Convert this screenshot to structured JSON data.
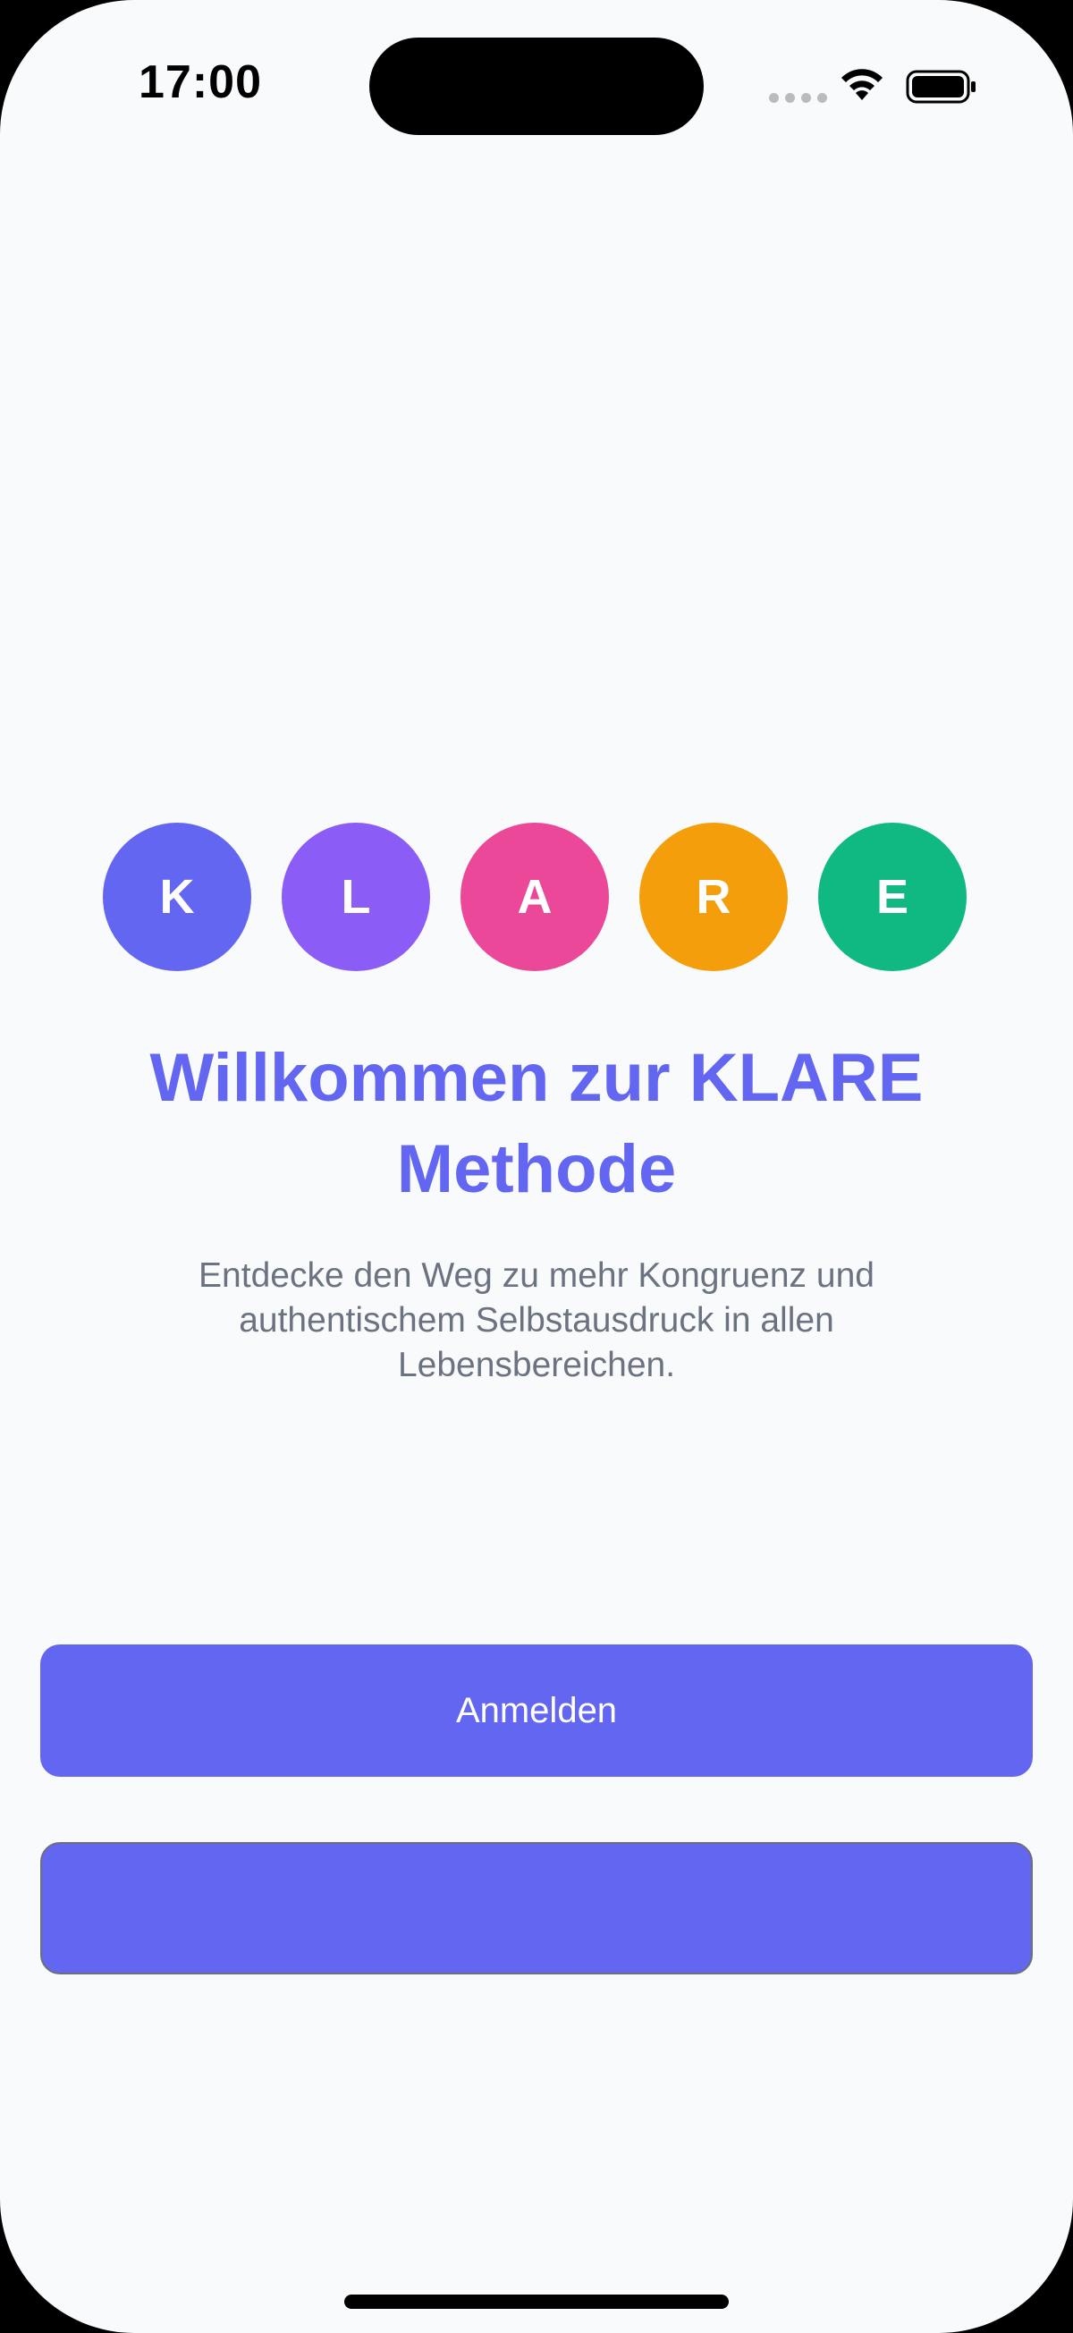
{
  "status_bar": {
    "time": "17:00",
    "icons": [
      "cellular-signal-icon",
      "wifi-icon",
      "battery-icon"
    ]
  },
  "colors": {
    "background": "#F8FAFC",
    "primary": "#6366F1",
    "subtitle": "#6B7280"
  },
  "letters": [
    {
      "char": "K",
      "color": "#6366F1"
    },
    {
      "char": "L",
      "color": "#8B5CF6"
    },
    {
      "char": "A",
      "color": "#EC4899"
    },
    {
      "char": "R",
      "color": "#F59E0B"
    },
    {
      "char": "E",
      "color": "#10B981"
    }
  ],
  "welcome": {
    "title": "Willkommen zur KLARE Methode",
    "subtitle": "Entdecke den Weg zu mehr Kongruenz und authentischem Selbstausdruck in allen Lebensbereichen."
  },
  "buttons": {
    "login_label": "Anmelden",
    "second_label": ""
  }
}
